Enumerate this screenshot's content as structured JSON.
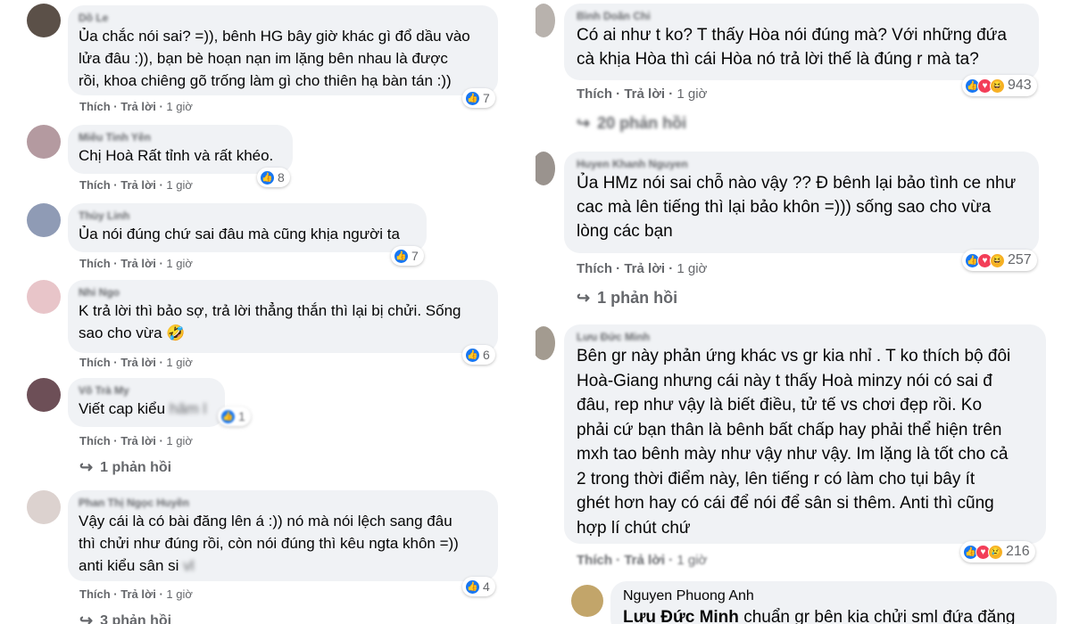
{
  "left": {
    "comments": [
      {
        "name": "Dồ Le",
        "text": "Ủa chắc nói sai? =)), bênh HG bây giờ khác gì đổ dầu vào\nlửa đâu :)), bạn bè hoạn nạn im lặng bên nhau là được\nrồi, khoa chiêng gõ trống làm gì cho thiên hạ bàn tán :))",
        "reactions": "7",
        "like": "Thích",
        "reply": "Trả lời",
        "time": "1 giờ"
      },
      {
        "name": "Miêu Tinh Yên",
        "text": "Chị Hoà Rất tỉnh và rất khéo.",
        "reactions": "8",
        "like": "Thích",
        "reply": "Trả lời",
        "time": "1 giờ"
      },
      {
        "name": "Thùy Linh",
        "text": "Ủa nói đúng chứ sai đâu mà cũng khịa người ta",
        "reactions": "7",
        "like": "Thích",
        "reply": "Trả lời",
        "time": "1 giờ"
      },
      {
        "name": "Nhi Ngo",
        "text": "K trả lời thì bảo sợ, trả lời thẳng thắn thì lại bị chửi. Sống\nsao cho vừa 🤣",
        "reactions": "6",
        "like": "Thích",
        "reply": "Trả lời",
        "time": "1 giờ"
      },
      {
        "name": "Võ Trà My",
        "text": "Viết cap kiểu",
        "text_blur": "hâm l",
        "reactions": "1",
        "like": "Thích",
        "reply": "Trả lời",
        "time": "1 giờ",
        "replies": "1 phản hồi"
      },
      {
        "name": "Phan Thị Ngọc Huyền",
        "text": "Vậy cái là có bài đăng lên á :)) nó mà nói lệch sang đâu\nthì chửi như đúng rồi, còn nói đúng thì kêu ngta khôn =))\nanti kiểu sân si",
        "text_blur": "vl",
        "reactions": "4",
        "like": "Thích",
        "reply": "Trả lời",
        "time": "1 giờ",
        "replies": "3 phản hồi"
      }
    ]
  },
  "right": {
    "comments": [
      {
        "name": "Bình Doãn Chi",
        "text": "Có ai như t ko? T thấy Hòa nói đúng mà? Với những đứa\ncà khịa Hòa thì cái Hòa nó trả lời thế là đúng r mà ta?",
        "reactions": "943",
        "like": "Thích",
        "reply": "Trả lời",
        "time": "1 giờ",
        "replies": "20 phản hồi"
      },
      {
        "name": "Huyen Khanh Nguyen",
        "text": "Ủa HMz nói sai chỗ nào vậy ?? Đ bênh lại bảo tình ce như\ncac mà lên tiếng thì lại bảo khôn =))) sống sao cho vừa\nlòng các bạn",
        "reactions": "257",
        "like": "Thích",
        "reply": "Trả lời",
        "time": "1 giờ",
        "replies": "1 phản hồi"
      },
      {
        "name": "Lưu Đức Minh",
        "text": "Bên gr này phản ứng khác vs gr kia nhỉ . T ko thích bộ đôi\nHoà-Giang nhưng cái này t thấy Hoà minzy nói có sai đ\nđâu, rep như vậy là biết điều, tử tế vs chơi đẹp rồi. Ko\nphải cứ bạn thân là bênh bất chấp hay phải thể hiện trên\nmxh tao bênh mày như vậy như vậy. Im lặng là tốt cho cả\n2 trong thời điểm này, lên tiếng r có làm cho tụi bây ít\nghét hơn hay có cái để nói để sân si thêm. Anti thì cũng\nhợp lí chút chứ",
        "reactions": "216",
        "like": "Thích",
        "reply": "Trả lời",
        "time": "1 giờ"
      }
    ],
    "reply": {
      "name": "Nguyen Phuong Anh",
      "mention": "Lưu Đức Minh",
      "text": "chuẩn gr bên kia chửi sml đứa đăng"
    }
  }
}
